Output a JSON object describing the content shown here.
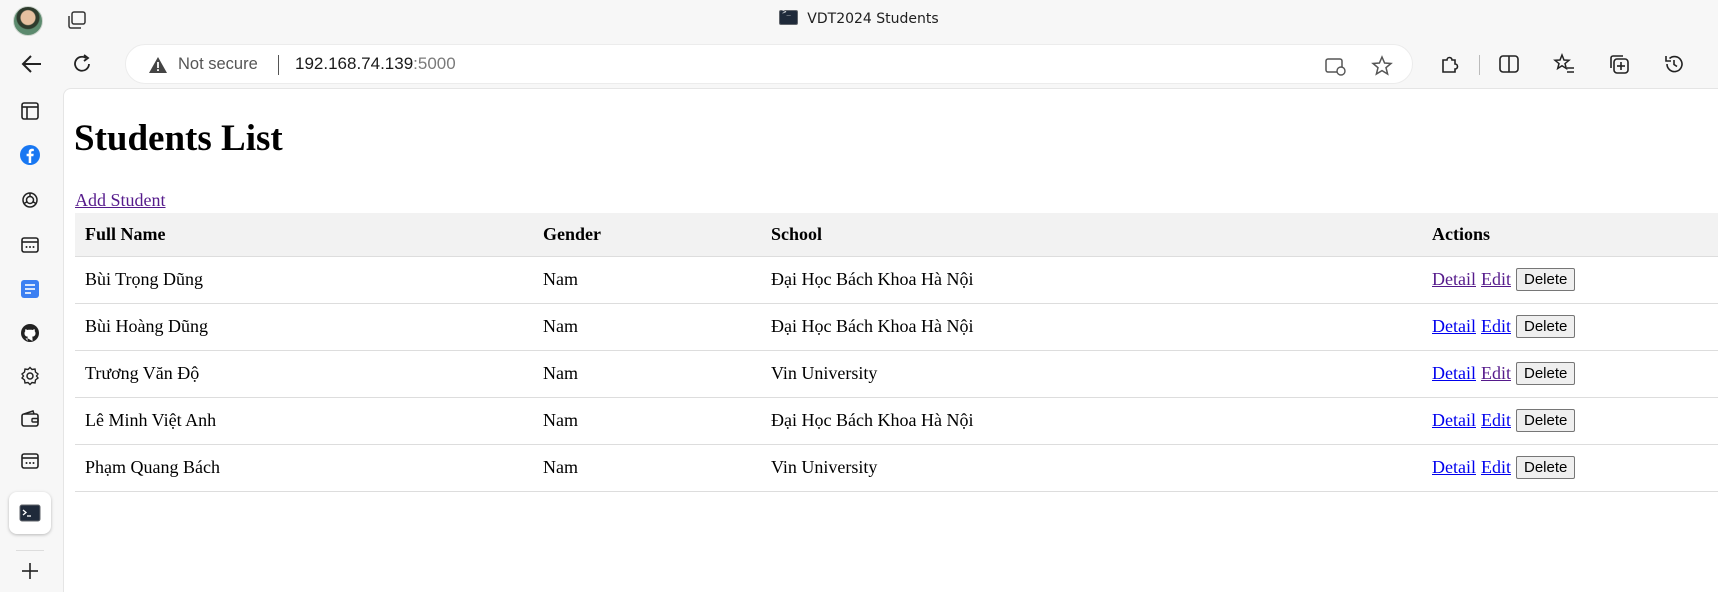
{
  "window": {
    "title": "VDT2024 Students"
  },
  "browser": {
    "security_label": "Not secure",
    "url_host": "192.168.74.139",
    "url_port": ":5000"
  },
  "sidebar": {
    "items": [
      {
        "icon": "sidebar-toggle-icon"
      },
      {
        "icon": "facebook-icon"
      },
      {
        "icon": "chatgpt-icon"
      },
      {
        "icon": "app-window-icon"
      },
      {
        "icon": "docs-icon"
      },
      {
        "icon": "github-icon"
      },
      {
        "icon": "settings-icon"
      },
      {
        "icon": "wallet-icon"
      },
      {
        "icon": "app-window-icon"
      },
      {
        "icon": "terminal-icon"
      },
      {
        "icon": "plus-icon"
      }
    ]
  },
  "page": {
    "heading": "Students List",
    "add_link": "Add Student",
    "columns": [
      "Full Name",
      "Gender",
      "School",
      "Actions"
    ],
    "rows": [
      {
        "name": "Bùi Trọng Dũng",
        "gender": "Nam",
        "school": "Đại Học Bách Khoa Hà Nội",
        "detail": "Detail",
        "edit": "Edit",
        "delete": "Delete",
        "detail_visited": true,
        "edit_visited": true
      },
      {
        "name": "Bùi Hoàng Dũng",
        "gender": "Nam",
        "school": "Đại Học Bách Khoa Hà Nội",
        "detail": "Detail",
        "edit": "Edit",
        "delete": "Delete",
        "detail_visited": false,
        "edit_visited": false
      },
      {
        "name": "Trương Văn Độ",
        "gender": "Nam",
        "school": "Vin University",
        "detail": "Detail",
        "edit": "Edit",
        "delete": "Delete",
        "detail_visited": false,
        "edit_visited": true
      },
      {
        "name": "Lê Minh Việt Anh",
        "gender": "Nam",
        "school": "Đại Học Bách Khoa Hà Nội",
        "detail": "Detail",
        "edit": "Edit",
        "delete": "Delete",
        "detail_visited": false,
        "edit_visited": false
      },
      {
        "name": "Phạm Quang Bách",
        "gender": "Nam",
        "school": "Vin University",
        "detail": "Detail",
        "edit": "Edit",
        "delete": "Delete",
        "detail_visited": false,
        "edit_visited": false
      }
    ]
  },
  "colors": {
    "link": "#0000ee",
    "link_visited": "#551a8b",
    "header_bg": "#f2f2f2"
  }
}
